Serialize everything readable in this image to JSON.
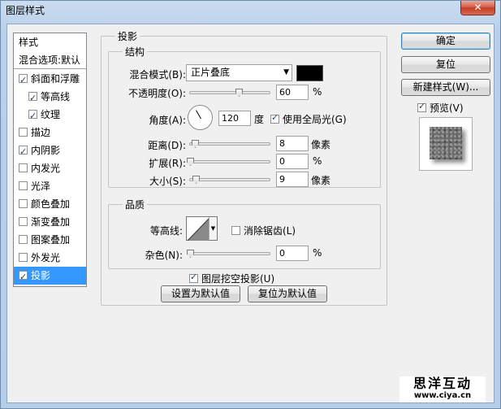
{
  "window": {
    "title": "图层样式",
    "close_label": "✕"
  },
  "style_list": {
    "header": "样式",
    "blend_options": "混合选项:默认",
    "items": [
      {
        "label": "斜面和浮雕",
        "checked": true
      },
      {
        "label": "等高线",
        "checked": true
      },
      {
        "label": "纹理",
        "checked": true
      },
      {
        "label": "描边",
        "checked": false
      },
      {
        "label": "内阴影",
        "checked": true
      },
      {
        "label": "内发光",
        "checked": false
      },
      {
        "label": "光泽",
        "checked": false
      },
      {
        "label": "颜色叠加",
        "checked": false
      },
      {
        "label": "渐变叠加",
        "checked": false
      },
      {
        "label": "图案叠加",
        "checked": false
      },
      {
        "label": "外发光",
        "checked": false
      },
      {
        "label": "投影",
        "checked": true,
        "selected": true
      }
    ]
  },
  "drop_shadow": {
    "title": "投影",
    "structure": {
      "title": "结构",
      "blend_mode_label": "混合模式(B):",
      "blend_mode_value": "正片叠底",
      "blend_color": "#000000",
      "opacity_label": "不透明度(O):",
      "opacity_value": "60",
      "opacity_unit": "%",
      "opacity_fraction": 0.6,
      "angle_label": "角度(A):",
      "angle_value": "120",
      "angle_unit": "度",
      "global_light_label": "使用全局光(G)",
      "global_light_checked": true,
      "distance_label": "距离(D):",
      "distance_value": "8",
      "distance_unit": "像素",
      "spread_label": "扩展(R):",
      "spread_value": "0",
      "spread_unit": "%",
      "size_label": "大小(S):",
      "size_value": "9",
      "size_unit": "像素"
    },
    "quality": {
      "title": "品质",
      "contour_label": "等高线:",
      "anti_alias_label": "消除锯齿(L)",
      "anti_alias_checked": false,
      "noise_label": "杂色(N):",
      "noise_value": "0",
      "noise_unit": "%"
    },
    "knockout_label": "图层挖空投影(U)",
    "knockout_checked": true,
    "make_default_label": "设置为默认值",
    "reset_default_label": "复位为默认值"
  },
  "buttons": {
    "ok": "确定",
    "reset": "复位",
    "new_style": "新建样式(W)...",
    "preview_label": "预览(V)",
    "preview_checked": true
  },
  "watermark": {
    "name": "思洋互动",
    "url": "www.ciya.cn"
  }
}
